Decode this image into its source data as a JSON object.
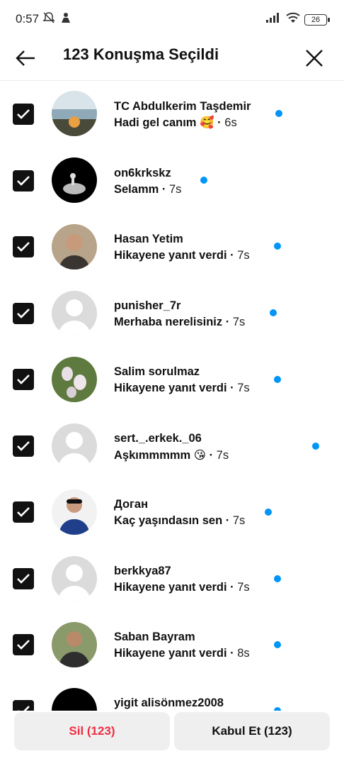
{
  "status_bar": {
    "time": "0:57",
    "battery": "26"
  },
  "header": {
    "title": "123 Konuşma Seçildi"
  },
  "conversations": [
    {
      "username": "TC Abdulkerim Taşdemir",
      "message": "Hadi gel canım 🥰",
      "time": "6s"
    },
    {
      "username": "on6krkskz",
      "message": "Selamm",
      "time": "7s"
    },
    {
      "username": "Hasan Yetim",
      "message": "Hikayene yanıt verdi",
      "time": "7s"
    },
    {
      "username": "punisher_7r",
      "message": "Merhaba nerelisiniz",
      "time": "7s"
    },
    {
      "username": "Salim sorulmaz",
      "message": "Hikayene yanıt verdi",
      "time": "7s"
    },
    {
      "username": "sert._.erkek._06",
      "message": "Aşkımmmmm 😘",
      "time": "7s"
    },
    {
      "username": "Доган",
      "message": "Kaç yaşındasın sen",
      "time": "7s"
    },
    {
      "username": "berkkya87",
      "message": "Hikayene yanıt verdi",
      "time": "7s"
    },
    {
      "username": "Saban Bayram",
      "message": "Hikayene yanıt verdi",
      "time": "8s"
    },
    {
      "username": "yigit alisönmez2008",
      "message": "",
      "time": ""
    }
  ],
  "footer": {
    "delete_label": "Sil (123)",
    "accept_label": "Kabul Et (123)"
  },
  "colors": {
    "unread_dot": "#0095f6",
    "delete_text": "#ed2f44",
    "button_bg": "#efefef"
  }
}
